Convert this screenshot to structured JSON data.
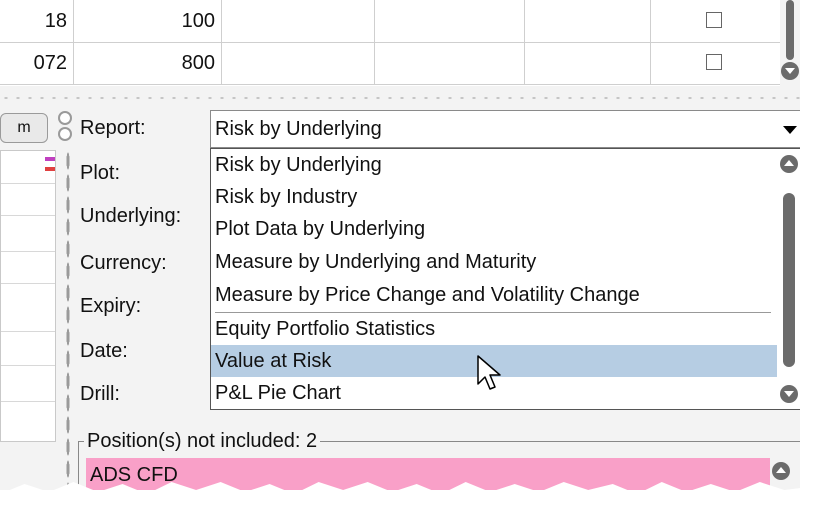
{
  "top_table": {
    "rows": [
      {
        "col0": "18",
        "col1": "100"
      },
      {
        "col0": "072",
        "col1": "800"
      }
    ]
  },
  "left_stub": {
    "button_label": "m"
  },
  "form": {
    "labels": {
      "report": "Report:",
      "plot": "Plot:",
      "underlying": "Underlying:",
      "currency": "Currency:",
      "expiry": "Expiry:",
      "date": "Date:",
      "drill": "Drill:"
    },
    "report_value": "Risk by Underlying"
  },
  "dropdown": {
    "options": [
      "Risk by Underlying",
      "Risk by Industry",
      "Plot Data by Underlying",
      "Measure by Underlying and Maturity",
      "Measure by Price Change and Volatility Change",
      "Equity Portfolio Statistics",
      "Value at Risk",
      "P&L Pie Chart"
    ],
    "highlighted": "Value at Risk"
  },
  "positions_group": {
    "title": "Position(s) not included: 2",
    "rows": [
      "ADS CFD"
    ]
  },
  "colors": {
    "highlight": "#b6cde3",
    "pink_row": "#f9a0c8",
    "yellow_row": "#f4f093",
    "scrollbar": "#6b6b6b"
  }
}
